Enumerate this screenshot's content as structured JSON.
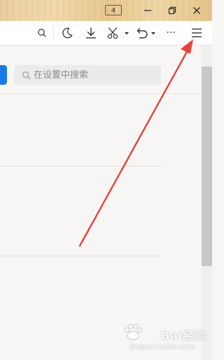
{
  "titlebar": {
    "tab_count": "4",
    "buttons": {
      "minimize": "minimize-icon",
      "restore": "restore-icon",
      "close": "close-icon"
    }
  },
  "toolbar": {
    "icons": [
      "search-icon",
      "moon-icon",
      "download-icon",
      "scissors-icon",
      "undo-icon",
      "more-icon",
      "menu-icon"
    ],
    "more_label": "···"
  },
  "settings": {
    "search_placeholder": "在设置中搜索"
  },
  "watermark": {
    "brand": "Bai经验",
    "url": "jingyan.baidu.com"
  },
  "colors": {
    "accent_blue": "#1a7be8",
    "annotation_red": "#e8403b",
    "titlebar_wood": "#e9cf9f"
  }
}
